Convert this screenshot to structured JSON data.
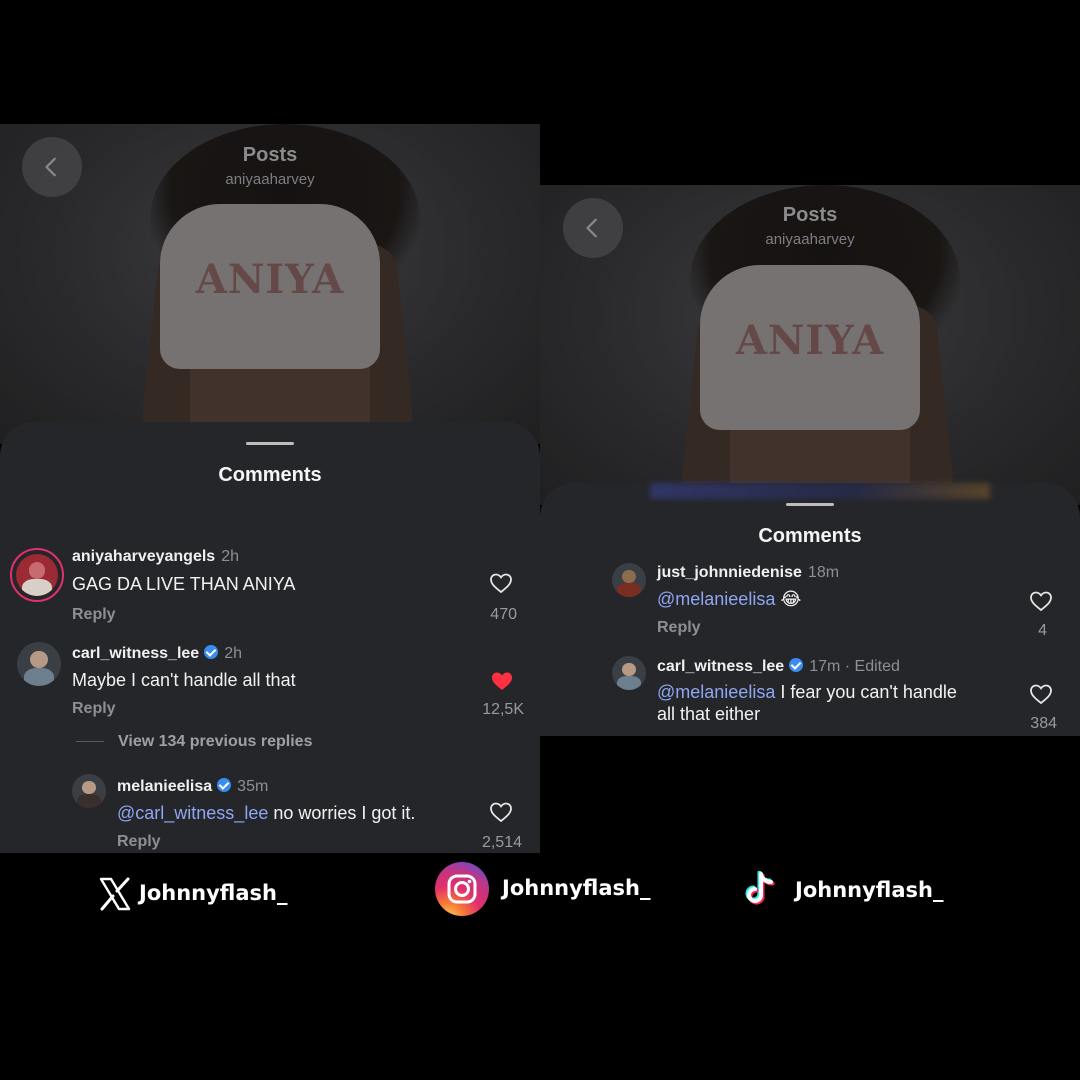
{
  "left": {
    "header": {
      "title": "Posts",
      "subtitle": "aniyaaharvey"
    },
    "photo_text": "ANIYA",
    "sheet_title": "Comments",
    "comments": [
      {
        "username": "aniyaharveyangels",
        "time": "2h",
        "text": "GAG DA LIVE THAN ANIYA",
        "reply": "Reply",
        "likes": "470",
        "liked": false
      },
      {
        "username": "carl_witness_lee",
        "time": "2h",
        "text": "Maybe I can't handle all that",
        "reply": "Reply",
        "likes": "12,5K",
        "liked": true,
        "verified": true
      }
    ],
    "view_replies": "View 134 previous replies",
    "reply_comment": {
      "username": "melanieelisa",
      "time": "35m",
      "mention": "@carl_witness_lee",
      "text": " no worries I got it.",
      "reply": "Reply",
      "likes": "2,514",
      "verified": true
    }
  },
  "right": {
    "header": {
      "title": "Posts",
      "subtitle": "aniyaaharvey"
    },
    "photo_text": "ANIYA",
    "sheet_title": "Comments",
    "comments": [
      {
        "username": "just_johnniedenise",
        "time": "18m",
        "mention": "@melanieelisa",
        "text": " 😂",
        "reply": "Reply",
        "likes": "4"
      },
      {
        "username": "carl_witness_lee",
        "time": "17m · Edited",
        "mention": "@melanieelisa",
        "text": " I fear you can't handle",
        "text2": "all that either",
        "likes": "384",
        "verified": true
      }
    ]
  },
  "footer": {
    "x_handle": "Johnnyflash_",
    "instagram_handle": "Johnnyflash_",
    "tiktok_handle": "Johnnyflash_"
  },
  "colors": {
    "sheet": "#25262a",
    "mention": "#8fa6f2",
    "liked_heart": "#ff3040",
    "verified": "#3a8cf0"
  },
  "icons": [
    "back-chevron-icon",
    "heart-icon",
    "verified-badge-icon",
    "x-logo-icon",
    "instagram-logo-icon",
    "tiktok-logo-icon"
  ]
}
